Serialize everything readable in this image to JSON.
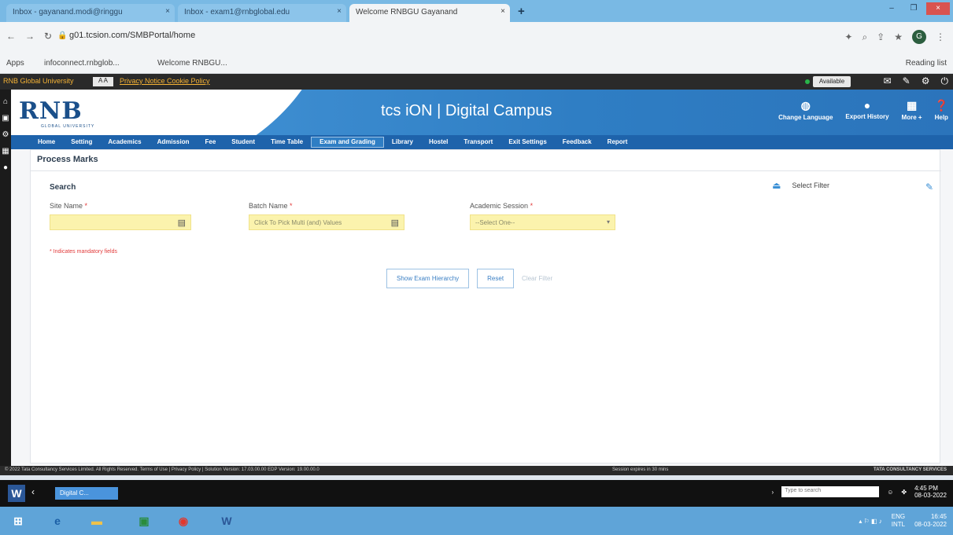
{
  "browser": {
    "tabs": [
      {
        "label": "Inbox - gayanand.modi@ringgu",
        "active": false
      },
      {
        "label": "Inbox - exam1@rnbglobal.edu",
        "active": false
      },
      {
        "label": "Welcome RNBGU Gayanand",
        "active": true
      }
    ],
    "new_tab": "+",
    "url": "g01.tcsion.com/SMBPortal/home",
    "bookmarks": [
      "Apps",
      "infoconnect.rnbglob...",
      "Welcome RNBGU..."
    ],
    "reading_list": "Reading list",
    "profile_initial": "G"
  },
  "app": {
    "university": "RNB Global University",
    "header_links": "Privacy Notice   Cookie Policy",
    "status": "Available",
    "logo": "RNB",
    "logo_sub": "GLOBAL UNIVERSITY",
    "product": "tcs iON | Digital Campus",
    "top_actions": [
      {
        "label": "Change Language",
        "icon": "globe-icon"
      },
      {
        "label": "Export History",
        "icon": "export-icon"
      },
      {
        "label": "More +",
        "icon": "grid-icon"
      },
      {
        "label": "Help",
        "icon": "help-icon"
      }
    ],
    "menu": [
      "Home",
      "Setting",
      "Academics",
      "Admission",
      "Fee",
      "Student",
      "Time Table",
      "Exam and Grading",
      "Library",
      "Hostel",
      "Transport",
      "Exit Settings",
      "Feedback",
      "Report"
    ],
    "active_menu": "Exam and Grading",
    "page_title": "Process Marks",
    "search_heading": "Search",
    "select_filter": "Select Filter",
    "fields": {
      "site_name": {
        "label": "Site Name",
        "placeholder": ""
      },
      "batch_name": {
        "label": "Batch Name",
        "placeholder": "Click To Pick Multi (and) Values"
      },
      "academic_session": {
        "label": "Academic Session",
        "value": "--Select One--"
      }
    },
    "mandatory_note": "* Indicates mandatory fields",
    "buttons": {
      "show": "Show Exam Hierarchy",
      "reset": "Reset",
      "clear": "Clear Filter"
    },
    "footer": {
      "left": "© 2022 Tata Consultancy Services Limited. All Rights Reserved.  Terms of Use | Privacy Policy | Solution Version: 17.03.00.00  EDP Version: 19.00.00.0",
      "middle": "Session expires in 30 mins",
      "right": "TATA CONSULTANCY SERVICES"
    }
  },
  "remote_taskbar": {
    "task_label": "Digital C...",
    "search_placeholder": "Type to search",
    "time": "4:45 PM",
    "date": "08-03-2022"
  },
  "taskbar": {
    "lang": "ENG",
    "region": "INTL",
    "time": "16:45",
    "date": "08-03-2022"
  }
}
